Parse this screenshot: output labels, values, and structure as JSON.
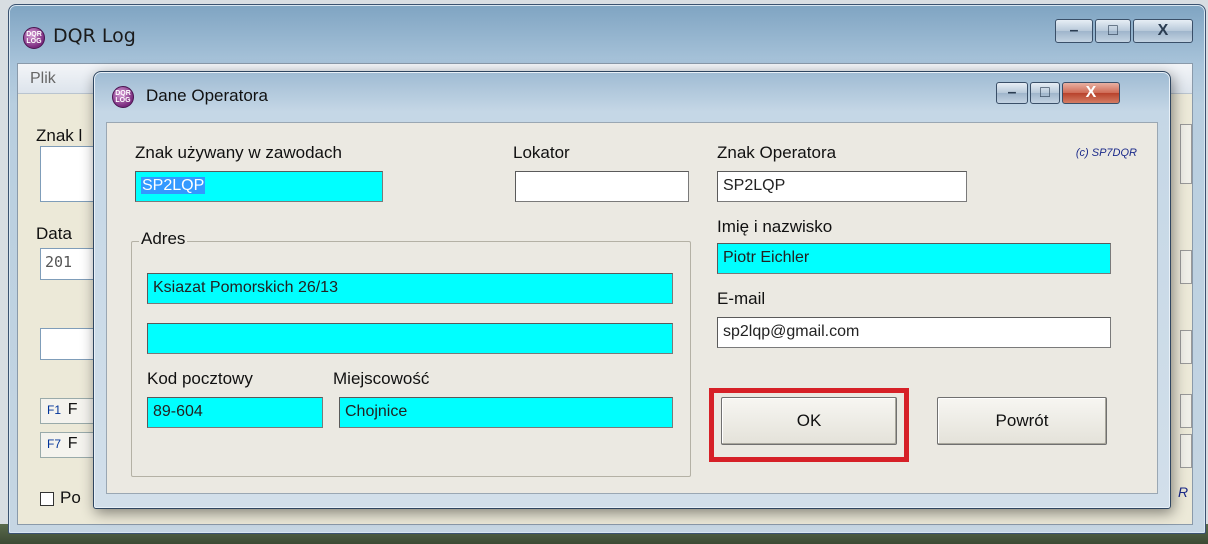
{
  "main_window": {
    "title": "DQR Log",
    "icon": "dqr-log-app-icon",
    "icon_text": "DQR LOG",
    "controls": {
      "minimize": "–",
      "maximize": "□",
      "close": "X"
    },
    "menu": {
      "file": "Plik"
    },
    "background_labels": {
      "znak": "Znak l",
      "data": "Data",
      "date_value": "201",
      "f1": "F1",
      "f1_suffix": "F",
      "f7": "F7",
      "f7_suffix": "F",
      "checkbox_label": "Po",
      "right_fragment": "R"
    }
  },
  "dialog": {
    "title": "Dane Operatora",
    "icon": "dqr-log-app-icon",
    "controls": {
      "minimize": "–",
      "maximize": "□",
      "close": "X"
    },
    "copyright": "(c) SP7DQR",
    "fields": {
      "contest_callsign_label": "Znak używany w zawodach",
      "contest_callsign_value": "SP2LQP",
      "locator_label": "Lokator",
      "locator_value": "",
      "operator_callsign_label": "Znak Operatora",
      "operator_callsign_value": "SP2LQP",
      "name_label": "Imię i nazwisko",
      "name_value": "Piotr Eichler",
      "email_label": "E-mail",
      "email_value": "sp2lqp@gmail.com",
      "address_group_label": "Adres",
      "address_line1": "Ksiazat Pomorskich 26/13",
      "address_line2": "",
      "postal_code_label": "Kod pocztowy",
      "postal_code_value": "89-604",
      "city_label": "Miejscowość",
      "city_value": "Chojnice"
    },
    "buttons": {
      "ok": "OK",
      "back": "Powrót"
    },
    "colors": {
      "required_field": "#00ffff",
      "highlight": "#d62027"
    }
  }
}
